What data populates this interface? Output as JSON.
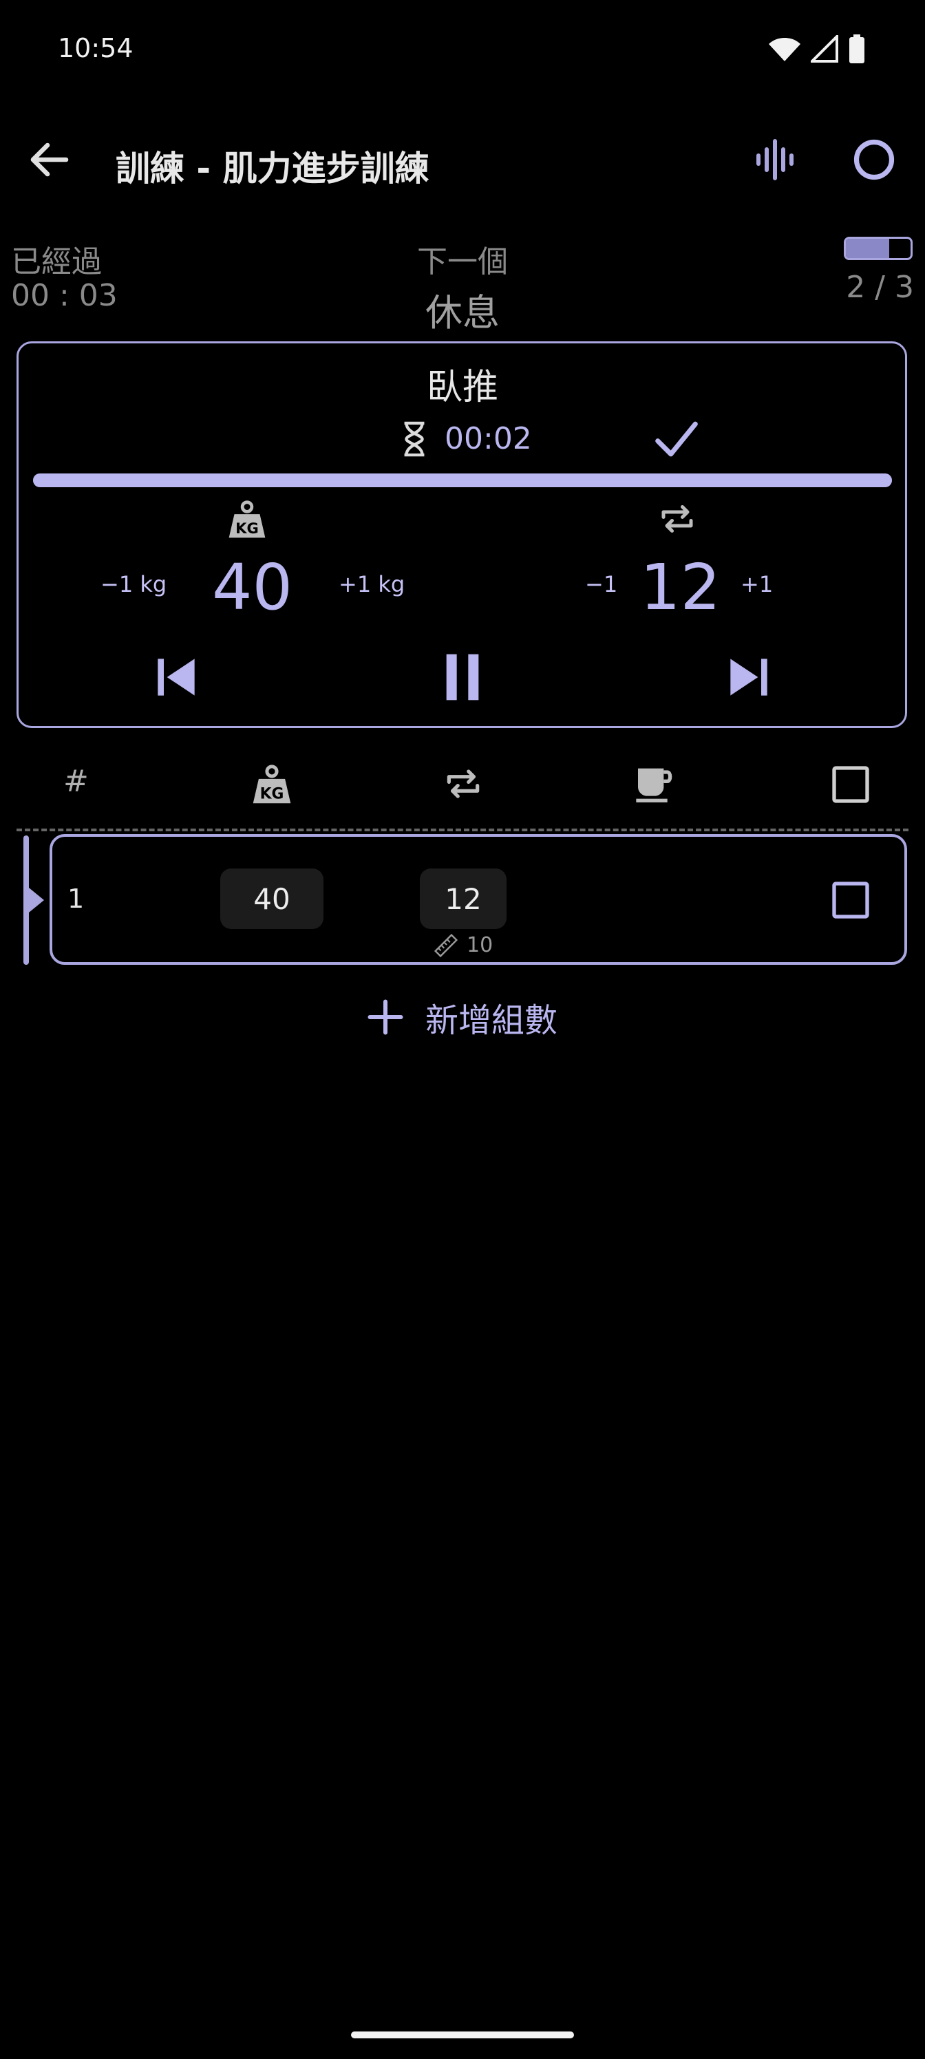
{
  "status_bar": {
    "time": "10:54",
    "icons": [
      "wifi-icon",
      "cell-signal-icon",
      "battery-icon"
    ]
  },
  "top_bar": {
    "back_icon": "arrow-back-icon",
    "title": "訓練 - 肌力進步訓練",
    "actions": [
      "waveform-icon",
      "circle-icon"
    ]
  },
  "info": {
    "elapsed_label": "已經過",
    "elapsed_value": "00 : 03",
    "next_label": "下一個",
    "next_value": "休息",
    "progress_text": "2 / 3",
    "progress_fraction": 0.67
  },
  "current": {
    "exercise_name": "臥推",
    "timer": "00:02",
    "progress_fraction": 1.0,
    "weight": {
      "minus_label": "−1 kg",
      "value": "40",
      "plus_label": "+1 kg"
    },
    "reps": {
      "minus_label": "−1",
      "value": "12",
      "plus_label": "+1"
    },
    "controls": [
      "skip-previous-icon",
      "pause-icon",
      "skip-next-icon"
    ]
  },
  "table": {
    "header": {
      "number": "#",
      "icons": [
        "weight-kg-icon",
        "repeat-icon",
        "coffee-cup-icon",
        "checkbox-icon"
      ]
    },
    "rows": [
      {
        "number": "1",
        "weight": "40",
        "reps": "12",
        "target_reps": "10",
        "done": false
      }
    ]
  },
  "add_set": {
    "label": "新增組數"
  },
  "colors": {
    "accent": "#b9b6f0",
    "border": "#a9a6e0",
    "background": "#000000",
    "chip": "#1c1c1c"
  }
}
